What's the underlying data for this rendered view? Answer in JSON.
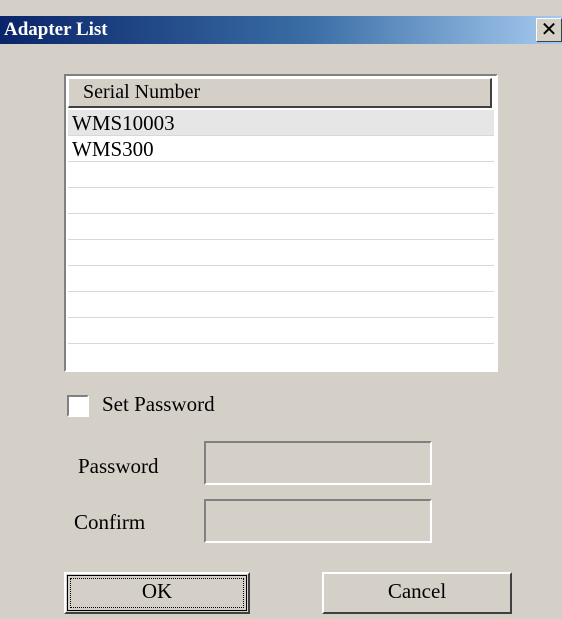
{
  "window": {
    "title": "Adapter List",
    "close_glyph": "✕",
    "close_icon": "close-icon"
  },
  "list": {
    "column_header": "Serial Number",
    "rows": [
      {
        "label": "WMS10003",
        "selected": true
      },
      {
        "label": "WMS300",
        "selected": false
      },
      {
        "label": ""
      },
      {
        "label": ""
      },
      {
        "label": ""
      },
      {
        "label": ""
      },
      {
        "label": ""
      },
      {
        "label": ""
      },
      {
        "label": ""
      }
    ]
  },
  "set_password": {
    "label": "Set Password",
    "checked": false
  },
  "password": {
    "label": "Password",
    "value": ""
  },
  "confirm": {
    "label": "Confirm",
    "value": ""
  },
  "buttons": {
    "ok": "OK",
    "cancel": "Cancel"
  }
}
